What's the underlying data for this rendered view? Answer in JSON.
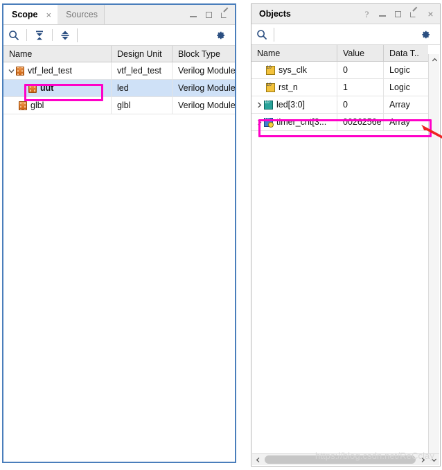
{
  "scope_panel": {
    "tabs": [
      {
        "label": "Scope",
        "active": true,
        "closable": true
      },
      {
        "label": "Sources",
        "active": false,
        "closable": false
      }
    ],
    "close_glyph": "×",
    "window_controls": [
      {
        "name": "minimize-button",
        "icon": "minimize-icon"
      },
      {
        "name": "maximize-button",
        "icon": "maximize-icon"
      },
      {
        "name": "float-button",
        "icon": "float-icon"
      }
    ],
    "toolbar": [
      {
        "name": "search-button",
        "icon": "search-icon"
      },
      {
        "name": "collapse-all-button",
        "icon": "collapse-all-icon"
      },
      {
        "name": "expand-all-button",
        "icon": "expand-all-icon"
      },
      {
        "name": "settings-button",
        "icon": "gear-icon"
      }
    ],
    "columns": [
      "Name",
      "Design Unit",
      "Block Type"
    ],
    "rows": [
      {
        "name": "vtf_led_test",
        "design_unit": "vtf_led_test",
        "block_type": "Verilog Module",
        "depth": 0,
        "expanded": true,
        "has_children": true,
        "selected": false,
        "highlighted": false,
        "icon": "verilog-module-icon"
      },
      {
        "name": "uut",
        "design_unit": "led",
        "block_type": "Verilog Module",
        "depth": 1,
        "expanded": false,
        "has_children": false,
        "selected": true,
        "highlighted": true,
        "icon": "verilog-module-icon"
      },
      {
        "name": "glbl",
        "design_unit": "glbl",
        "block_type": "Verilog Module",
        "depth": 1,
        "expanded": false,
        "has_children": false,
        "selected": false,
        "highlighted": false,
        "icon": "verilog-module-icon"
      }
    ]
  },
  "objects_panel": {
    "title": "Objects",
    "window_controls": [
      {
        "name": "help-button",
        "icon": "help-icon",
        "glyph": "?"
      },
      {
        "name": "minimize-button",
        "icon": "minimize-icon"
      },
      {
        "name": "maximize-button",
        "icon": "maximize-icon"
      },
      {
        "name": "float-button",
        "icon": "float-icon"
      },
      {
        "name": "close-button",
        "icon": "close-icon",
        "glyph": "×"
      }
    ],
    "toolbar": [
      {
        "name": "search-button",
        "icon": "search-icon"
      },
      {
        "name": "settings-button",
        "icon": "gear-icon"
      }
    ],
    "search_value": "",
    "columns": [
      "Name",
      "Value",
      "Data T.."
    ],
    "rows": [
      {
        "name": "sys_clk",
        "value": "0",
        "data_type": "Logic",
        "has_children": false,
        "highlighted": false,
        "icon": "logic-signal-icon"
      },
      {
        "name": "rst_n",
        "value": "1",
        "data_type": "Logic",
        "has_children": false,
        "highlighted": false,
        "icon": "logic-signal-icon"
      },
      {
        "name": "led[3:0]",
        "value": "0",
        "data_type": "Array",
        "has_children": true,
        "highlighted": false,
        "icon": "array-signal-icon"
      },
      {
        "name": "timer_cnt[3...",
        "value": "0026256e",
        "data_type": "Array",
        "has_children": true,
        "highlighted": true,
        "icon": "register-signal-icon"
      }
    ],
    "vertical_scrollbar": {
      "up_glyph": "⌃",
      "down_glyph": "⌄"
    },
    "horizontal_scrollbar": {
      "left_glyph": "‹",
      "right_glyph": "›"
    }
  },
  "annotations": {
    "watermark": "https://blog.csdn.net/ReCclay",
    "highlight_color": "#ff00c8",
    "arrow_color": "#ee2222",
    "arrow_name": "red-pointer-arrow"
  }
}
